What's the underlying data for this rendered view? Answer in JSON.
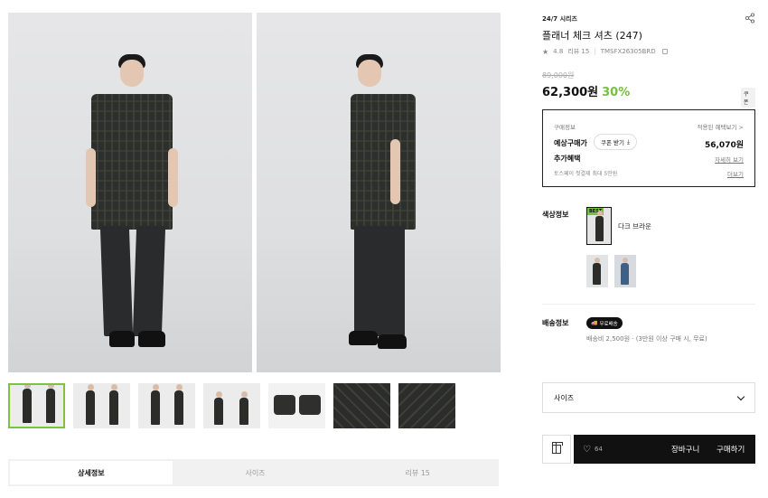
{
  "gallery": {
    "thumbnail_count": 7,
    "active_thumbnail": 0
  },
  "tabs": [
    {
      "label": "상세정보"
    },
    {
      "label": "사이즈"
    },
    {
      "label": "리뷰 15"
    }
  ],
  "product": {
    "series": "24/7 시리즈",
    "title": "플래너 체크 셔츠 (247)",
    "rating": "4.8",
    "review": "리뷰 15",
    "code": "TMSFX26305BRD",
    "original_price": "89,000원",
    "price": "62,300원",
    "discount": "30%",
    "coupon_badge": "쿠폰"
  },
  "buy_box": {
    "label": "구매정보",
    "benefit_link": "적용된 혜택보기 >",
    "expected_title": "예상구매가",
    "coupon_button": "쿠폰 받기",
    "expected_amount": "56,070원",
    "extra_title": "추가혜택",
    "detail_link": "자세히 보기",
    "toss_note": "토스페이 첫결제 최대 5만원",
    "more_link": "더보기"
  },
  "color": {
    "label": "색상정보",
    "best_tag": "BEST",
    "selected_name": "다크 브라운"
  },
  "shipping": {
    "label": "배송정보",
    "free_badge": "무료배송",
    "detail": "배송비 2,500원 · (3만원 이상 구매 시, 무료)"
  },
  "size": {
    "label": "사이즈"
  },
  "actions": {
    "like_count": "64",
    "cart": "장바구니",
    "buy": "구매하기"
  },
  "colors": {
    "accent": "#76c043",
    "dark": "#111111"
  }
}
